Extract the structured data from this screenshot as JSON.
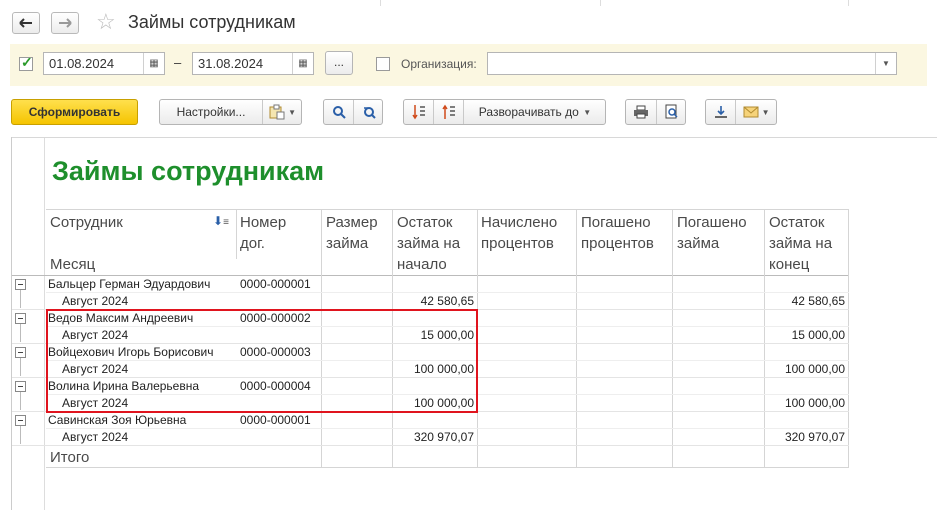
{
  "window": {
    "title": "Займы сотрудникам"
  },
  "filter": {
    "period_enabled": true,
    "date_from": "01.08.2024",
    "date_to": "31.08.2024",
    "dash": "–",
    "period_select_label": "...",
    "org_label": "Организация:",
    "org_value": ""
  },
  "toolbar": {
    "generate_label": "Сформировать",
    "settings_label": "Настройки...",
    "expand_label": "Разворачивать до"
  },
  "report": {
    "title": "Займы сотрудникам",
    "headers": {
      "employee": "Сотрудник",
      "month": "Месяц",
      "contract_l1": "Номер",
      "contract_l2": "дог.",
      "loan_l1": "Размер",
      "loan_l2": "займа",
      "bal_start_l1": "Остаток",
      "bal_start_l2": "займа на",
      "bal_start_l3": "начало",
      "interest_l1": "Начислено",
      "interest_l2": "процентов",
      "paid_int_l1": "Погашено",
      "paid_int_l2": "процентов",
      "paid_loan_l1": "Погашено",
      "paid_loan_l2": "займа",
      "bal_end_l1": "Остаток",
      "bal_end_l2": "займа на",
      "bal_end_l3": "конец"
    },
    "rows": [
      {
        "employee": "Бальцер Герман Эдуардович",
        "contract": "0000-000001",
        "month": "Август 2024",
        "start": "42 580,65",
        "end": "42 580,65"
      },
      {
        "employee": "Ведов Максим Андреевич",
        "contract": "0000-000002",
        "month": "Август 2024",
        "start": "15 000,00",
        "end": "15 000,00"
      },
      {
        "employee": "Войцехович Игорь Борисович",
        "contract": "0000-000003",
        "month": "Август 2024",
        "start": "100 000,00",
        "end": "100 000,00"
      },
      {
        "employee": "Волина Ирина Валерьевна",
        "contract": "0000-000004",
        "month": "Август 2024",
        "start": "100 000,00",
        "end": "100 000,00"
      },
      {
        "employee": "Савинская Зоя Юрьевна",
        "contract": "0000-000001",
        "month": "Август 2024",
        "start": "320 970,07",
        "end": "320 970,07"
      }
    ],
    "total_label": "Итого"
  }
}
